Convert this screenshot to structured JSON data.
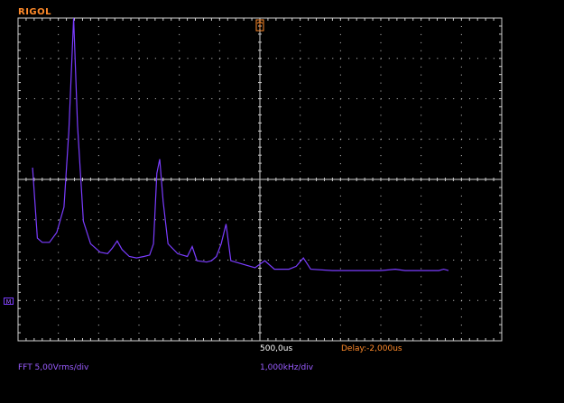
{
  "brand": "RIGOL",
  "status": {
    "timebase": "500,0us",
    "delay": "Delay:-2,000us"
  },
  "fft": {
    "vertical_scale": "FFT 5,00Vrms/div",
    "horizontal_scale": "1,000kHz/div",
    "channel_marker": "M"
  },
  "colors": {
    "trace": "#7a3cff",
    "grid": "#cfcfcf",
    "accent": "#ff8a2a",
    "label": "#9a5cff"
  },
  "icons": {
    "trigger": "trigger-position-icon"
  },
  "fft_spectrum": [
    [
      0.03,
      0.47
    ],
    [
      0.04,
      0.22
    ],
    [
      0.05,
      0.205
    ],
    [
      0.065,
      0.205
    ],
    [
      0.08,
      0.24
    ],
    [
      0.095,
      0.33
    ],
    [
      0.105,
      0.6
    ],
    [
      0.115,
      1.0
    ],
    [
      0.123,
      0.62
    ],
    [
      0.135,
      0.28
    ],
    [
      0.15,
      0.2
    ],
    [
      0.17,
      0.17
    ],
    [
      0.185,
      0.165
    ],
    [
      0.195,
      0.185
    ],
    [
      0.205,
      0.21
    ],
    [
      0.215,
      0.18
    ],
    [
      0.23,
      0.155
    ],
    [
      0.245,
      0.15
    ],
    [
      0.26,
      0.155
    ],
    [
      0.272,
      0.16
    ],
    [
      0.28,
      0.2
    ],
    [
      0.287,
      0.45
    ],
    [
      0.293,
      0.5
    ],
    [
      0.3,
      0.35
    ],
    [
      0.31,
      0.2
    ],
    [
      0.33,
      0.165
    ],
    [
      0.35,
      0.155
    ],
    [
      0.36,
      0.19
    ],
    [
      0.37,
      0.14
    ],
    [
      0.39,
      0.135
    ],
    [
      0.4,
      0.14
    ],
    [
      0.41,
      0.155
    ],
    [
      0.42,
      0.2
    ],
    [
      0.43,
      0.27
    ],
    [
      0.44,
      0.14
    ],
    [
      0.46,
      0.13
    ],
    [
      0.49,
      0.115
    ],
    [
      0.51,
      0.14
    ],
    [
      0.53,
      0.11
    ],
    [
      0.56,
      0.11
    ],
    [
      0.575,
      0.12
    ],
    [
      0.59,
      0.15
    ],
    [
      0.605,
      0.11
    ],
    [
      0.65,
      0.105
    ],
    [
      0.75,
      0.105
    ],
    [
      0.78,
      0.11
    ],
    [
      0.8,
      0.105
    ],
    [
      0.87,
      0.105
    ],
    [
      0.88,
      0.11
    ],
    [
      0.89,
      0.105
    ]
  ]
}
